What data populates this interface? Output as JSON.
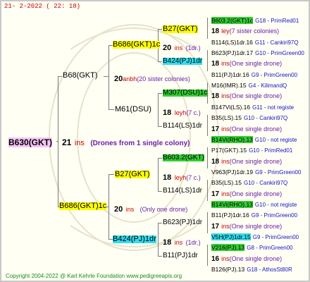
{
  "header": "21-  2-2022 ( 22: 18)",
  "copyright": "Copyright 2004-2022 @ Karl Kehrle Foundation   www.pedigreeapis.org",
  "root": {
    "name": "B630(GKT)",
    "num": "21",
    "unit": "ins",
    "note": "(Drones from 1 single colony)"
  },
  "gen1": {
    "top": {
      "name": "B68(GKT)",
      "num": "20",
      "unit": "anbh",
      "note": "(20 sister colonies)"
    },
    "bottom": {
      "name": "B686(GKT)1c",
      "num": "20",
      "unit": "ins",
      "note": "(Only one drone)"
    }
  },
  "gen2": {
    "a": {
      "name": "B686(GKT)1c",
      "num": "20",
      "unit": "ins",
      "note": "(1dr.)"
    },
    "b": {
      "name": "M61(DSU)",
      "num": "18",
      "unit": "leyh",
      "note": "(7 c.)"
    },
    "c": {
      "name": "B27(GKT)",
      "num": "18",
      "unit": "leyh",
      "note": "(7 c.)"
    },
    "d": {
      "name": "B424(PJ)1dr",
      "num": "18",
      "unit": "ins",
      "note": "(1dr.)"
    }
  },
  "gen3": {
    "a1": {
      "name": "B27(GKT)",
      "num": "20",
      "unit": "ins",
      "note": "(1dr.)"
    },
    "a2": {
      "name": "B424(PJ)1dr"
    },
    "b1": {
      "name": "M307(DSU)1c"
    },
    "b2": {
      "name": "B114(LS)1dr"
    },
    "c1": {
      "name": "B603.2(GKT)"
    },
    "c2": {
      "name": "B114(LS)1dr"
    },
    "d1": {
      "name": "B623(PJ)1dr"
    },
    "d2": {
      "name": "B11(PJ)1dr"
    }
  },
  "gen4": [
    {
      "name": "B603.2(GKT)1c",
      "ref": "G18 - PrimRed01"
    },
    {
      "num": "18",
      "unit": "ley",
      "note": "(7 sister colonies)"
    },
    {
      "name": "B114(LS)1dr.16",
      "ref": "G11 - Cankiri97Q"
    },
    {
      "name": "B623(PJ)1dr.17",
      "ref": "G10 - PrimGreen00"
    },
    {
      "num": "18",
      "unit": "ins",
      "note": "(One single drone)"
    },
    {
      "name": "B11(PJ)1dr.16",
      "ref": "G9 - PrimGreen00"
    },
    {
      "name": "M16(IMR).15",
      "ref": "G4 - KilimandQ"
    },
    {
      "num": "18",
      "unit": "ins",
      "note": "(One single drone)"
    },
    {
      "name": "B147Vi(LS).16",
      "ref": "G11 - not registe"
    },
    {
      "name": "B35(LS).15",
      "ref": "G10 - Cankiri97Q"
    },
    {
      "num": "17",
      "unit": "ins",
      "note": "(One single drone)"
    },
    {
      "name": "B14Vi(RHO).13",
      "ref": "G10 - not registe"
    },
    {
      "name": "P17(GKT).15",
      "ref": "G10 - PrimRed01"
    },
    {
      "num": "18",
      "unit": "ins",
      "note": "(One single drone)"
    },
    {
      "name": "V963(PJ)1dr.19",
      "ref": "G9 - PrimGreen00"
    },
    {
      "name": "B35(LS).15",
      "ref": "G10 - Cankiri97Q"
    },
    {
      "num": "17",
      "unit": "ins",
      "note": "(One single drone)"
    },
    {
      "name": "B14Vi(RHO).13",
      "ref": "G10 - not registe"
    },
    {
      "name": "B11(PJ)1dr.16",
      "ref": "G9 - PrimGreen00"
    },
    {
      "num": "17",
      "unit": "ins",
      "note": "(One single drone)"
    },
    {
      "name": "V5H(PJ)1dr.15",
      "ref": "G9 - PrimGreen00"
    },
    {
      "name": "V216(PJ).13",
      "ref": "G8 - PrimGreen00"
    },
    {
      "num": "16",
      "unit": "ins",
      "note": "(One single drone)"
    },
    {
      "name": "B126(PJ).13",
      "ref": "G18 - AthosSt80R"
    }
  ]
}
